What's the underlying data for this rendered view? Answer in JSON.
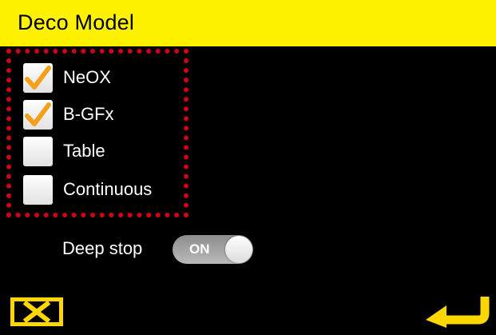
{
  "header": {
    "title": "Deco Model",
    "background": "#fff200"
  },
  "options": [
    {
      "label": "NeOX",
      "checked": true
    },
    {
      "label": "B-GFx",
      "checked": true
    },
    {
      "label": "Table",
      "checked": false
    },
    {
      "label": "Continuous",
      "checked": false
    }
  ],
  "deep_stop": {
    "label": "Deep stop",
    "toggle_text": "ON"
  },
  "icons": {
    "cancel": "close-icon",
    "enter": "return-arrow-icon",
    "check": "checkmark-icon"
  },
  "colors": {
    "accent_yellow": "#ffd700",
    "check_orange": "#f5a01a",
    "highlight_red": "#d0021b"
  }
}
